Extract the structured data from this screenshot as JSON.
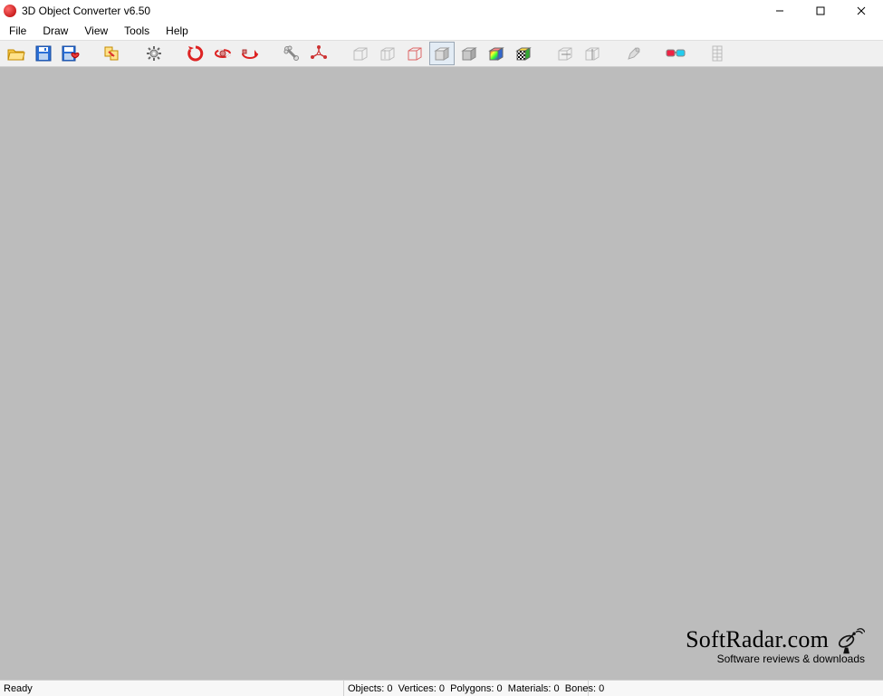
{
  "title": "3D Object Converter v6.50",
  "menu": {
    "file": "File",
    "draw": "Draw",
    "view": "View",
    "tools": "Tools",
    "help": "Help"
  },
  "toolbar_icons": {
    "open": "open-folder-icon",
    "save": "save-floppy-icon",
    "save_as": "save-floppy-heart-icon",
    "batch": "batch-convert-icon",
    "options": "gear-icon",
    "rotate_x": "rotate-red-icon",
    "rotate_y": "rotate-ring-icon",
    "rotate_z": "rotate-arrow-icon",
    "tool_bone": "bone-tool-icon",
    "tool_axes": "axes-tool-icon",
    "view_front": "cube-wire-front-icon",
    "view_side": "cube-wire-side-icon",
    "view_top": "cube-wire-red-icon",
    "shade_flat": "cube-solid-light-icon",
    "shade_smooth": "cube-solid-gray-icon",
    "shade_color": "cube-rainbow-icon",
    "shade_checker": "cube-checker-icon",
    "cull_front": "cube-wire-axis1-icon",
    "cull_back": "cube-wire-axis2-icon",
    "edit1": "edit-tool-gray-icon",
    "glasses": "glasses-3d-icon",
    "grid": "grid-column-icon"
  },
  "status": {
    "ready": "Ready",
    "objects_label": "Objects:",
    "objects": "0",
    "vertices_label": "Vertices:",
    "vertices": "0",
    "polygons_label": "Polygons:",
    "polygons": "0",
    "materials_label": "Materials:",
    "materials": "0",
    "bones_label": "Bones:",
    "bones": "0"
  },
  "watermark": {
    "line1": "SoftRadar.com",
    "line2": "Software reviews & downloads"
  }
}
